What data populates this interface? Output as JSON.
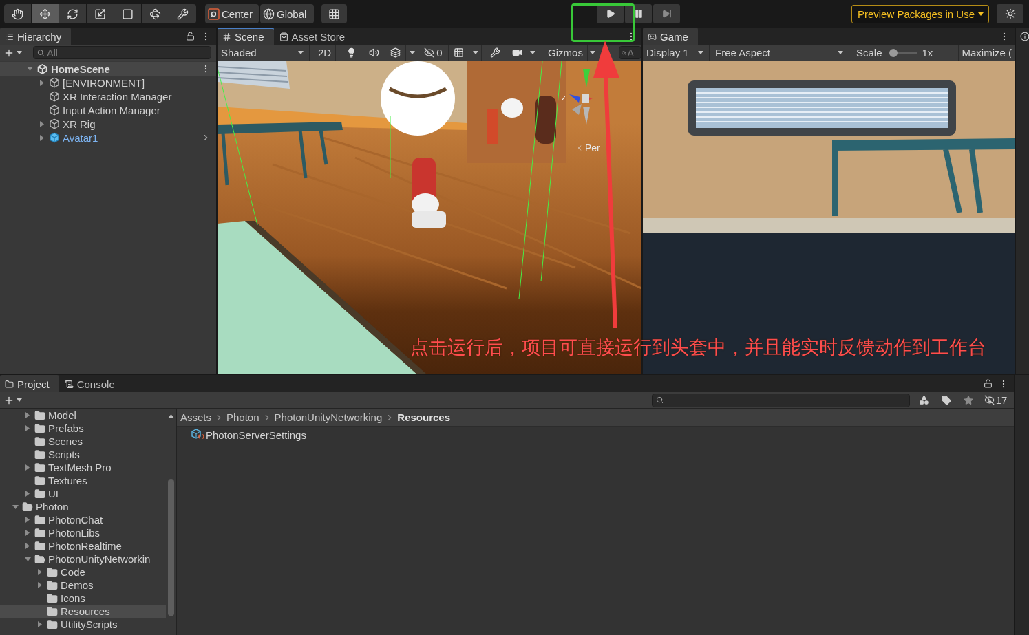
{
  "toolbar": {
    "tools": [
      {
        "kind": "hand",
        "selected": false
      },
      {
        "kind": "move",
        "selected": true
      },
      {
        "kind": "rotate",
        "selected": false
      },
      {
        "kind": "scale",
        "selected": false
      },
      {
        "kind": "rect",
        "selected": false
      },
      {
        "kind": "transform",
        "selected": false
      },
      {
        "kind": "custom",
        "selected": false
      }
    ],
    "pivot": [
      {
        "kind": "center",
        "label": "Center"
      },
      {
        "kind": "global",
        "label": "Global"
      }
    ],
    "playback": [
      {
        "kind": "play"
      },
      {
        "kind": "pause"
      },
      {
        "kind": "step"
      }
    ],
    "notice": "Preview Packages in Use"
  },
  "hierarchy": {
    "tabs": [
      {
        "label": "Hierarchy",
        "kind": "hierarchy",
        "selected": true
      }
    ],
    "search": {
      "placeholder": "All"
    },
    "scene": {
      "label": "HomeScene",
      "expanded": true,
      "children": [
        {
          "label": "[ENVIRONMENT]",
          "kind": "object",
          "expanded": false
        },
        {
          "label": "XR Interaction Manager",
          "kind": "object"
        },
        {
          "label": "Input Action Manager",
          "kind": "object"
        },
        {
          "label": "XR Rig",
          "kind": "object",
          "expanded": false
        },
        {
          "label": "Avatar1",
          "kind": "prefab",
          "expanded": false
        }
      ]
    }
  },
  "scene": {
    "tabs": [
      {
        "label": "Scene",
        "kind": "scene",
        "selected": true,
        "focused": true
      },
      {
        "label": "Asset Store",
        "kind": "store",
        "selected": false,
        "focused": false
      }
    ],
    "toolbar": {
      "shading": "Shaded",
      "mode_2d": "2D",
      "hidden_count": "0",
      "gizmos": "Gizmos",
      "search": {
        "placeholder": "A"
      }
    },
    "view": {
      "axis_label": "z",
      "projection": "Per"
    }
  },
  "game": {
    "tabs": [
      {
        "label": "Game",
        "kind": "game",
        "selected": true
      }
    ],
    "display": "Display 1",
    "aspect": "Free Aspect",
    "scale": {
      "label": "Scale",
      "level": 0,
      "reading": "1x"
    },
    "maximize": "Maximize ("
  },
  "project": {
    "tabs": [
      {
        "label": "Project",
        "kind": "project",
        "selected": true
      },
      {
        "label": "Console",
        "kind": "console",
        "selected": false
      }
    ],
    "hidden_count": "17",
    "tree": [
      {
        "children": [
          {
            "label": "Model",
            "expanded": false,
            "selected": false
          },
          {
            "label": "Prefabs",
            "expanded": false,
            "selected": false
          },
          {
            "label": "Scenes",
            "selected": false
          },
          {
            "label": "Scripts",
            "selected": false
          },
          {
            "label": "TextMesh Pro",
            "expanded": false,
            "selected": false
          },
          {
            "label": "Textures",
            "selected": false
          },
          {
            "label": "UI",
            "expanded": false,
            "selected": false
          }
        ]
      },
      {
        "label": "Photon",
        "expanded": true,
        "selected": false,
        "children": [
          {
            "label": "PhotonChat",
            "expanded": false,
            "selected": false
          },
          {
            "label": "PhotonLibs",
            "expanded": false,
            "selected": false
          },
          {
            "label": "PhotonRealtime",
            "expanded": false,
            "selected": false
          },
          {
            "label": "PhotonUnityNetworkin",
            "expanded": true,
            "selected": false,
            "children": [
              {
                "label": "Code",
                "expanded": false,
                "selected": false
              },
              {
                "label": "Demos",
                "expanded": false,
                "selected": false
              },
              {
                "label": "Icons",
                "selected": false
              },
              {
                "label": "Resources",
                "selected": true
              },
              {
                "label": "UtilityScripts",
                "expanded": false,
                "selected": false
              }
            ]
          }
        ]
      }
    ],
    "breadcrumb": [
      "Assets",
      "Photon",
      "PhotonUnityNetworking",
      "Resources"
    ],
    "files": [
      {
        "label": "PhotonServerSettings",
        "kind": "settings"
      }
    ]
  },
  "annotation": {
    "text": "点击运行后，项目可直接运行到头套中，并且能实时反馈动作到工作台"
  }
}
